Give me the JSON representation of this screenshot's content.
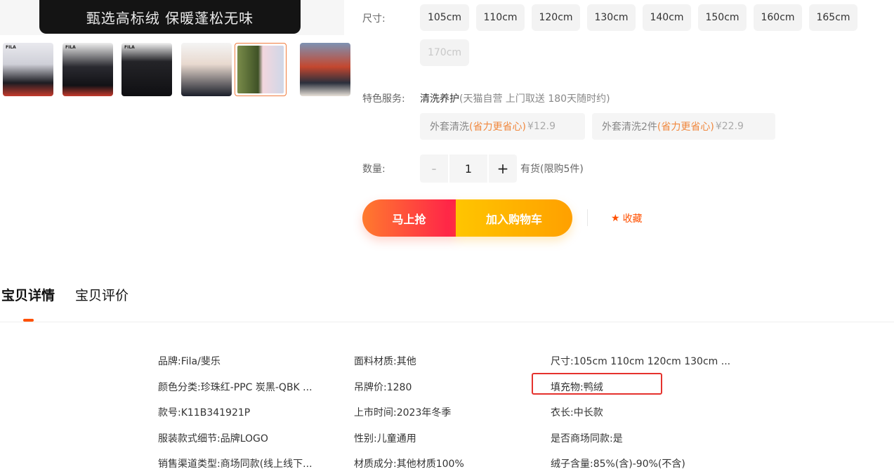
{
  "banner": {
    "text": "甄选高标绒 保暖蓬松无味"
  },
  "gallery": {
    "thumbnails": [
      {
        "name": "thumb-1",
        "label": "FILA"
      },
      {
        "name": "thumb-2",
        "label": "FILA"
      },
      {
        "name": "thumb-3",
        "label": "FILA"
      },
      {
        "name": "thumb-4",
        "label": ""
      },
      {
        "name": "thumb-5",
        "label": ""
      },
      {
        "name": "thumb-6",
        "label": ""
      }
    ]
  },
  "size": {
    "label": "尺寸:",
    "options": [
      "105cm",
      "110cm",
      "120cm",
      "130cm",
      "140cm",
      "150cm",
      "160cm",
      "165cm",
      "170cm"
    ]
  },
  "service": {
    "label": "特色服务:",
    "name": "清洗养护",
    "note": "(天猫自营 上门取送 180天随时约)",
    "options": [
      {
        "title": "外套清洗",
        "highlight": "(省力更省心)",
        "price": "¥12.9"
      },
      {
        "title": "外套清洗2件",
        "highlight": "(省力更省心)",
        "price": "¥22.9"
      }
    ]
  },
  "quantity": {
    "label": "数量:",
    "minus": "-",
    "plus": "+",
    "value": "1",
    "stock": "有货(限购5件)"
  },
  "actions": {
    "buy": "马上抢",
    "cart": "加入购物车",
    "favorite": "收藏"
  },
  "tabs": [
    "宝贝详情",
    "宝贝评价"
  ],
  "attributes": {
    "col1": [
      "品牌:Fila/斐乐",
      "颜色分类:珍珠红-PPC 炭黑-QBK ...",
      "款号:K11B341921P",
      "服装款式细节:品牌LOGO",
      "销售渠道类型:商场同款(线上线下..."
    ],
    "col2": [
      "面料材质:其他",
      "吊牌价:1280",
      "上市时间:2023年冬季",
      "性别:儿童通用",
      "材质成分:其他材质100%"
    ],
    "col3": [
      "尺寸:105cm 110cm 120cm 130cm ...",
      "填充物:鸭绒",
      "衣长:中长款",
      "是否商场同款:是",
      "绒子含量:85%(含)-90%(不含)"
    ]
  },
  "colors": {
    "accent": "#ff5000",
    "highlight_box": "#e5322d"
  }
}
